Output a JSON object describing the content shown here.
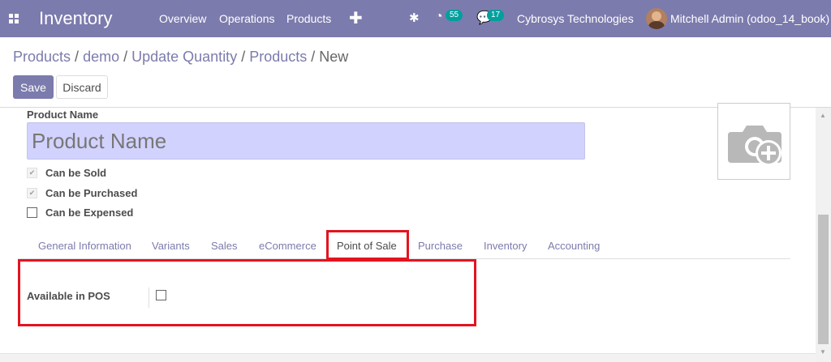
{
  "navbar": {
    "app_title": "Inventory",
    "menu": [
      "Overview",
      "Operations",
      "Products"
    ],
    "activity_count": "55",
    "message_count": "17",
    "company": "Cybrosys Technologies",
    "user": "Mitchell Admin (odoo_14_book)"
  },
  "breadcrumb": [
    "Products",
    "demo",
    "Update Quantity",
    "Products",
    "New"
  ],
  "buttons": {
    "save": "Save",
    "discard": "Discard"
  },
  "form": {
    "product_name_label": "Product Name",
    "product_name_placeholder": "Product Name",
    "checkboxes": [
      {
        "label": "Can be Sold",
        "checked": true
      },
      {
        "label": "Can be Purchased",
        "checked": true
      },
      {
        "label": "Can be Expensed",
        "checked": false
      }
    ]
  },
  "tabs": [
    "General Information",
    "Variants",
    "Sales",
    "eCommerce",
    "Point of Sale",
    "Purchase",
    "Inventory",
    "Accounting"
  ],
  "active_tab": "Point of Sale",
  "pos_tab": {
    "available_label": "Available in POS",
    "available_checked": false
  },
  "colors": {
    "brand": "#7c7bad",
    "badge": "#00a09d",
    "highlight": "#e3141f",
    "name_input_bg": "#d2d2ff"
  },
  "icons": [
    "apps-grid-icon",
    "plus-icon",
    "bug-icon",
    "activity-icon",
    "chat-icon",
    "camera-add-icon"
  ]
}
